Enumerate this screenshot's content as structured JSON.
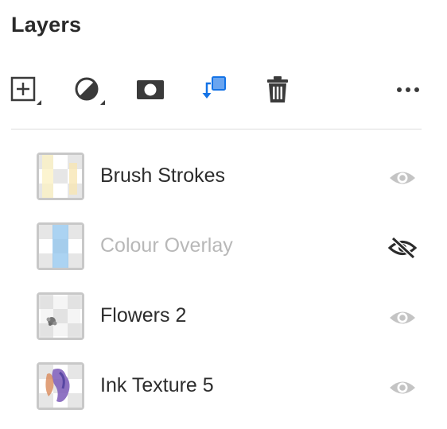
{
  "panel": {
    "title": "Layers"
  },
  "toolbar": {
    "items": [
      {
        "icon": "add-layer-icon"
      },
      {
        "icon": "adjustment-icon"
      },
      {
        "icon": "mask-icon"
      },
      {
        "icon": "clipping-mask-icon"
      },
      {
        "icon": "trash-icon"
      },
      {
        "icon": "more-options-icon"
      }
    ],
    "accent_color": "#1473e6"
  },
  "layers": [
    {
      "name": "Brush Strokes",
      "visible": true
    },
    {
      "name": "Colour Overlay",
      "visible": false
    },
    {
      "name": "Flowers 2",
      "visible": true
    },
    {
      "name": "Ink Texture 5",
      "visible": true
    }
  ]
}
